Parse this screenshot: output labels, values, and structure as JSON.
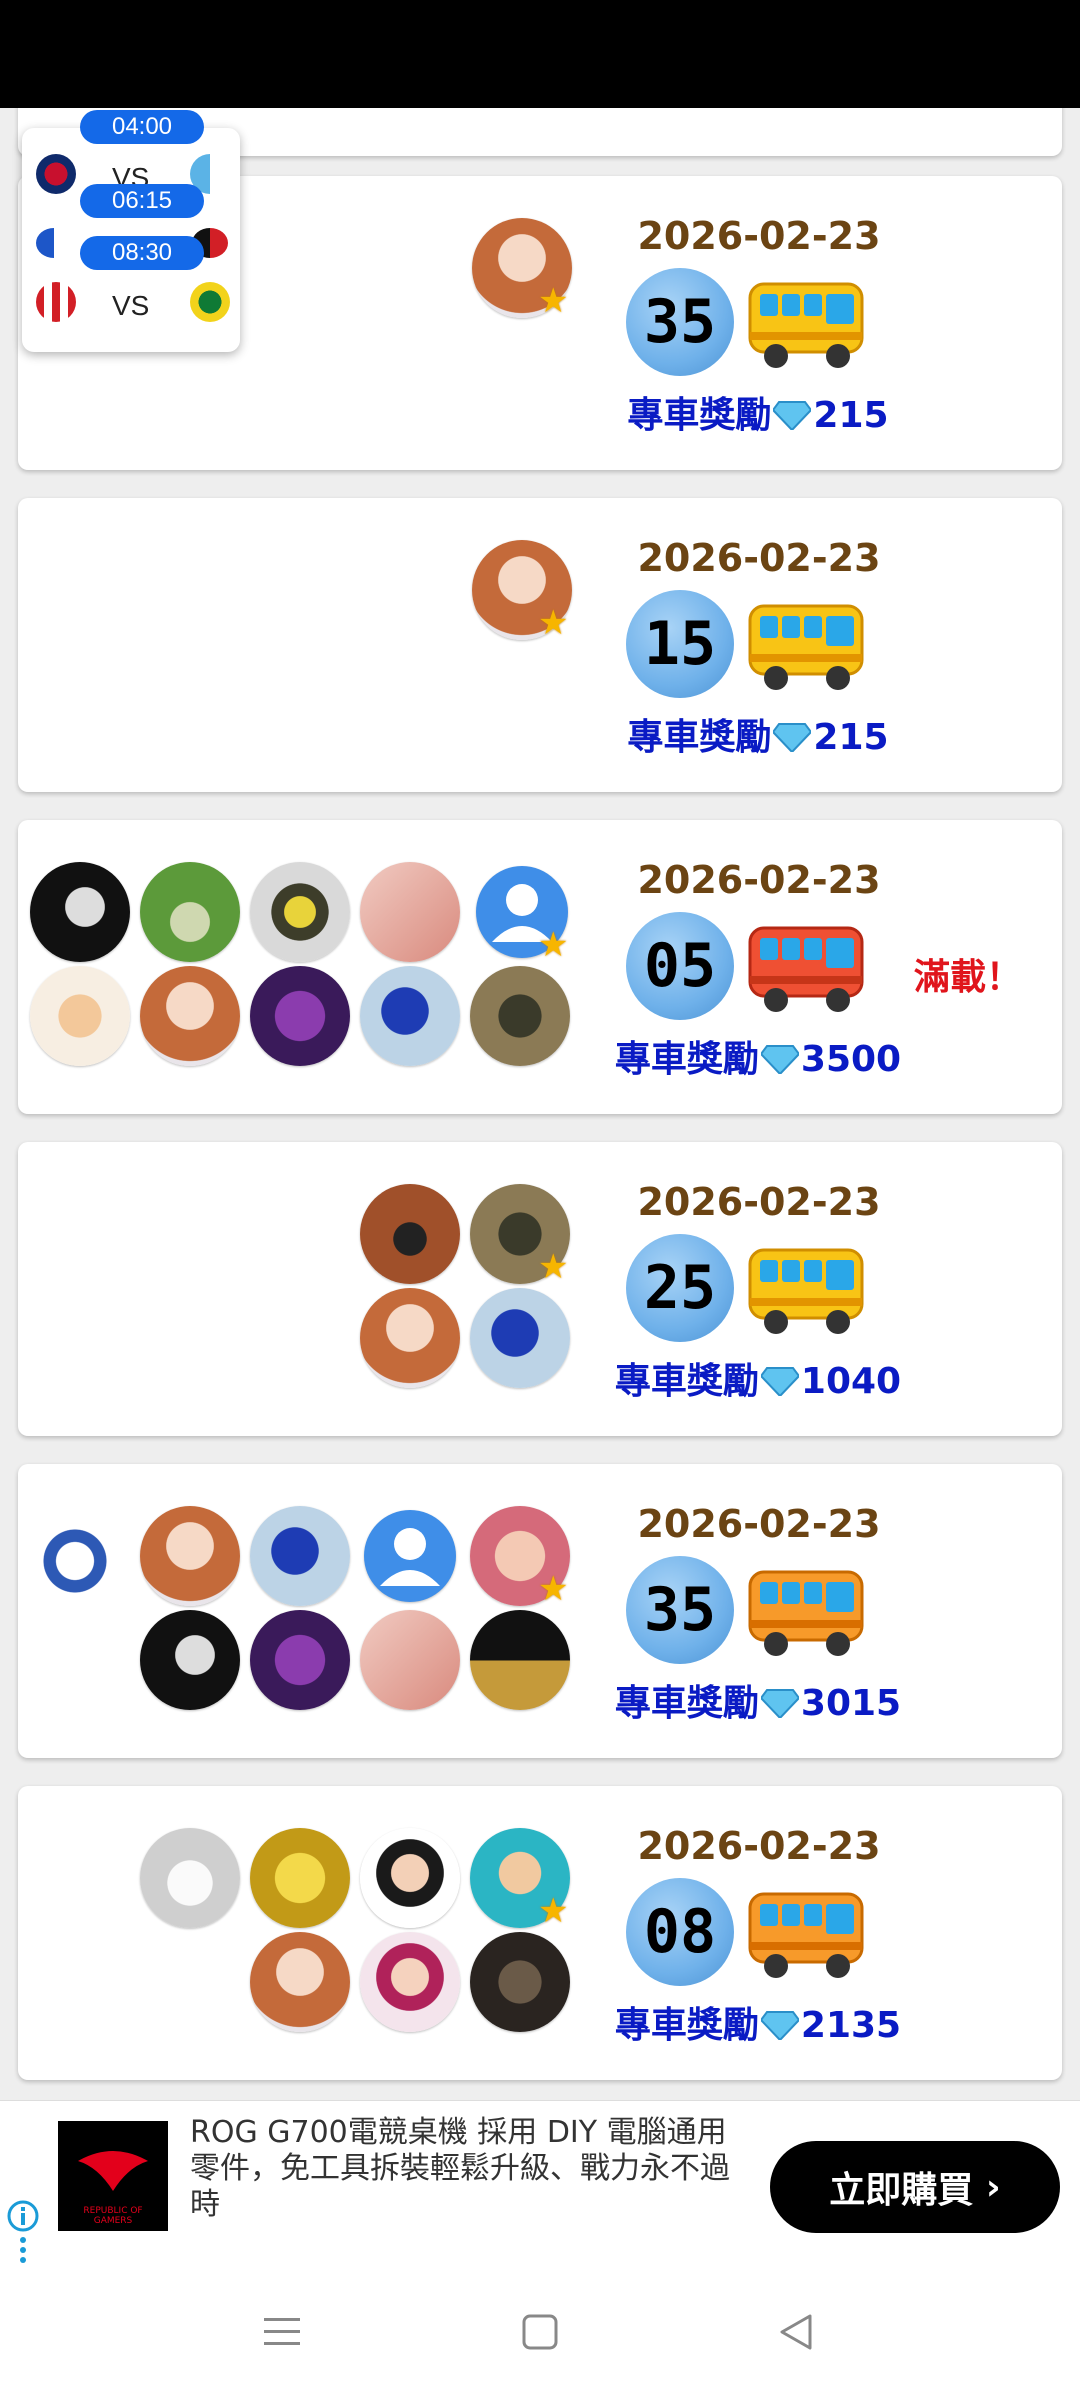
{
  "popup": {
    "matches": [
      {
        "time": "04:00",
        "vs": "VS"
      },
      {
        "time": "06:15",
        "vs": ""
      },
      {
        "time": "08:30",
        "vs": "VS"
      }
    ]
  },
  "cards": [
    {
      "date": "2026-02-23",
      "number": "35",
      "reward_label": "專車獎勵",
      "reward_value": "215",
      "bus_color": "yellow",
      "full_label": ""
    },
    {
      "date": "2026-02-23",
      "number": "15",
      "reward_label": "專車獎勵",
      "reward_value": "215",
      "bus_color": "yellow",
      "full_label": ""
    },
    {
      "date": "2026-02-23",
      "number": "05",
      "reward_label": "專車獎勵",
      "reward_value": "3500",
      "bus_color": "red",
      "full_label": "滿載！"
    },
    {
      "date": "2026-02-23",
      "number": "25",
      "reward_label": "專車獎勵",
      "reward_value": "1040",
      "bus_color": "yellow",
      "full_label": ""
    },
    {
      "date": "2026-02-23",
      "number": "35",
      "reward_label": "專車獎勵",
      "reward_value": "3015",
      "bus_color": "orange",
      "full_label": ""
    },
    {
      "date": "2026-02-23",
      "number": "08",
      "reward_label": "專車獎勵",
      "reward_value": "2135",
      "bus_color": "orange",
      "full_label": ""
    }
  ],
  "ad": {
    "text": "ROG G700電競桌機 採用 DIY 電腦通用零件，免工具拆裝輕鬆升級、戰力永不過時",
    "cta": "立即購買",
    "cta_arrow": "›"
  },
  "colors": {
    "date": "#6b4413",
    "reward": "#0a1bc4",
    "full": "#e0151c",
    "pill": "#1469e8"
  }
}
